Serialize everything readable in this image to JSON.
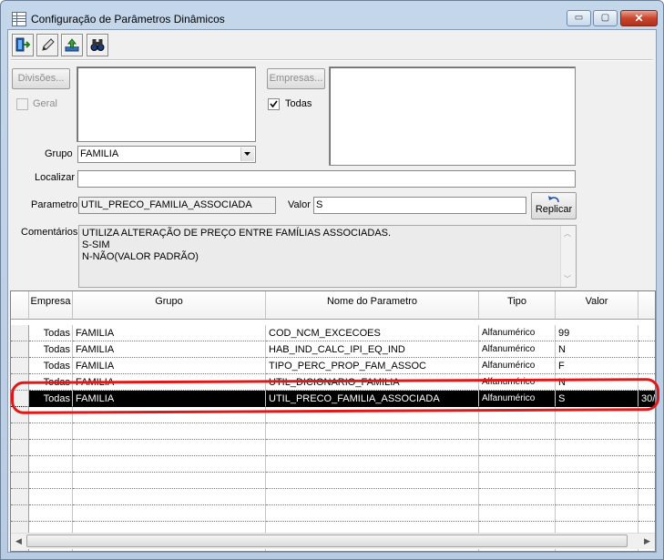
{
  "window": {
    "title": "Configuração de Parâmetros Dinâmicos",
    "minimize_glyph": "▭",
    "maximize_glyph": "▢",
    "close_glyph": "✕"
  },
  "toolbar": {
    "icons": [
      "exit-door-icon",
      "pencil-edit-icon",
      "upload-tray-icon",
      "binoculars-search-icon"
    ]
  },
  "filters": {
    "divisoes_button": "Divisões...",
    "geral_label": "Geral",
    "geral_checked": false,
    "empresas_button": "Empresas...",
    "todas_label": "Todas",
    "todas_checked": true,
    "grupo_label": "Grupo",
    "grupo_value": "FAMILIA",
    "localizar_label": "Localizar",
    "localizar_value": "",
    "parametro_label": "Parametro",
    "parametro_value": "UTIL_PRECO_FAMILIA_ASSOCIADA",
    "valor_label": "Valor",
    "valor_value": "S",
    "replicar_button": "Replicar",
    "comentarios_label": "Comentários",
    "comentarios_lines": [
      "UTILIZA ALTERAÇÃO DE PREÇO ENTRE FAMÍLIAS ASSOCIADAS.",
      "S-SIM",
      "N-NÃO(VALOR PADRÃO)"
    ]
  },
  "grid": {
    "columns": [
      "Empresa",
      "Grupo",
      "Nome do Parametro",
      "Tipo",
      "Valor"
    ],
    "rows": [
      {
        "empresa": "Todas",
        "grupo": "FAMILIA",
        "nome": "COD_NCM_EXCECOES",
        "tipo": "Alfanumérico",
        "valor": "99",
        "extra": ""
      },
      {
        "empresa": "Todas",
        "grupo": "FAMILIA",
        "nome": "HAB_IND_CALC_IPI_EQ_IND",
        "tipo": "Alfanumérico",
        "valor": "N",
        "extra": ""
      },
      {
        "empresa": "Todas",
        "grupo": "FAMILIA",
        "nome": "TIPO_PERC_PROP_FAM_ASSOC",
        "tipo": "Alfanumérico",
        "valor": "F",
        "extra": ""
      },
      {
        "empresa": "Todas",
        "grupo": "FAMILIA",
        "nome": "UTIL_DICIONARIO_FAMILIA",
        "tipo": "Alfanumérico",
        "valor": "N",
        "extra": ""
      },
      {
        "empresa": "Todas",
        "grupo": "FAMILIA",
        "nome": "UTIL_PRECO_FAMILIA_ASSOCIADA",
        "tipo": "Alfanumérico",
        "valor": "S",
        "extra": "30/"
      }
    ],
    "selected_row_index": 4
  },
  "colors": {
    "selection_bg": "#000000",
    "highlight_mark": "#e01818"
  }
}
